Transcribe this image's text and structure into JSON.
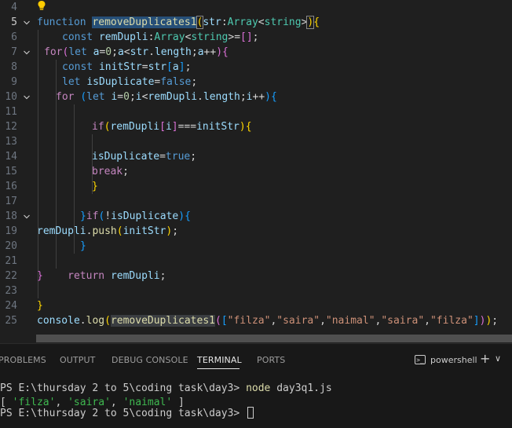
{
  "editor": {
    "line_numbers": [
      "4",
      "5",
      "6",
      "7",
      "8",
      "9",
      "10",
      "11",
      "12",
      "13",
      "14",
      "15",
      "16",
      "17",
      "18",
      "19",
      "20",
      "21",
      "22",
      "23",
      "24",
      "25"
    ],
    "lines": [
      {
        "tokens": []
      },
      {
        "tokens": [
          {
            "t": "function ",
            "c": "k"
          },
          {
            "t": "removeDuplicates1",
            "c": "f hl"
          },
          {
            "t": "(",
            "c": "b1 bracket-box"
          },
          {
            "t": "str",
            "c": "v"
          },
          {
            "t": ":",
            "c": "p"
          },
          {
            "t": "Array",
            "c": "t"
          },
          {
            "t": "<",
            "c": "p"
          },
          {
            "t": "string",
            "c": "t"
          },
          {
            "t": ">",
            "c": "p"
          },
          {
            "t": ")",
            "c": "b1 bracket-box"
          },
          {
            "t": "{",
            "c": "b1"
          }
        ]
      },
      {
        "tokens": [
          {
            "t": "const ",
            "c": "k"
          },
          {
            "t": "remDupli",
            "c": "v"
          },
          {
            "t": ":",
            "c": "p"
          },
          {
            "t": "Array",
            "c": "t"
          },
          {
            "t": "<",
            "c": "p"
          },
          {
            "t": "string",
            "c": "t"
          },
          {
            "t": ">",
            "c": "p"
          },
          {
            "t": "=",
            "c": "p"
          },
          {
            "t": "[]",
            "c": "b2"
          },
          {
            "t": ";",
            "c": "p"
          }
        ]
      },
      {
        "tokens": [
          {
            "t": "for",
            "c": "kc"
          },
          {
            "t": "(",
            "c": "b2"
          },
          {
            "t": "let ",
            "c": "k"
          },
          {
            "t": "a",
            "c": "v"
          },
          {
            "t": "=",
            "c": "p"
          },
          {
            "t": "0",
            "c": "n"
          },
          {
            "t": ";",
            "c": "p"
          },
          {
            "t": "a",
            "c": "v"
          },
          {
            "t": "<",
            "c": "p"
          },
          {
            "t": "str",
            "c": "v"
          },
          {
            "t": ".",
            "c": "p"
          },
          {
            "t": "length",
            "c": "v"
          },
          {
            "t": ";",
            "c": "p"
          },
          {
            "t": "a",
            "c": "v"
          },
          {
            "t": "++",
            "c": "p"
          },
          {
            "t": ")",
            "c": "b2"
          },
          {
            "t": "{",
            "c": "b2"
          }
        ]
      },
      {
        "tokens": [
          {
            "t": "const ",
            "c": "k"
          },
          {
            "t": "initStr",
            "c": "v"
          },
          {
            "t": "=",
            "c": "p"
          },
          {
            "t": "str",
            "c": "v"
          },
          {
            "t": "[",
            "c": "b3"
          },
          {
            "t": "a",
            "c": "v"
          },
          {
            "t": "]",
            "c": "b3"
          },
          {
            "t": ";",
            "c": "p"
          }
        ]
      },
      {
        "tokens": [
          {
            "t": "let ",
            "c": "k"
          },
          {
            "t": "isDuplicate",
            "c": "v"
          },
          {
            "t": "=",
            "c": "p"
          },
          {
            "t": "false",
            "c": "k"
          },
          {
            "t": ";",
            "c": "p"
          }
        ]
      },
      {
        "tokens": [
          {
            "t": "for ",
            "c": "kc"
          },
          {
            "t": "(",
            "c": "b3"
          },
          {
            "t": "let ",
            "c": "k"
          },
          {
            "t": "i",
            "c": "v"
          },
          {
            "t": "=",
            "c": "p"
          },
          {
            "t": "0",
            "c": "n"
          },
          {
            "t": ";",
            "c": "p"
          },
          {
            "t": "i",
            "c": "v"
          },
          {
            "t": "<",
            "c": "p"
          },
          {
            "t": "remDupli",
            "c": "v"
          },
          {
            "t": ".",
            "c": "p"
          },
          {
            "t": "length",
            "c": "v"
          },
          {
            "t": ";",
            "c": "p"
          },
          {
            "t": "i",
            "c": "v"
          },
          {
            "t": "++",
            "c": "p"
          },
          {
            "t": ")",
            "c": "b3"
          },
          {
            "t": "{",
            "c": "b3"
          }
        ]
      },
      {
        "tokens": []
      },
      {
        "tokens": [
          {
            "t": "if",
            "c": "kc"
          },
          {
            "t": "(",
            "c": "b1"
          },
          {
            "t": "remDupli",
            "c": "v"
          },
          {
            "t": "[",
            "c": "b2"
          },
          {
            "t": "i",
            "c": "v"
          },
          {
            "t": "]",
            "c": "b2"
          },
          {
            "t": "===",
            "c": "p"
          },
          {
            "t": "initStr",
            "c": "v"
          },
          {
            "t": ")",
            "c": "b1"
          },
          {
            "t": "{",
            "c": "b1"
          }
        ]
      },
      {
        "tokens": []
      },
      {
        "tokens": [
          {
            "t": "isDuplicate",
            "c": "v"
          },
          {
            "t": "=",
            "c": "p"
          },
          {
            "t": "true",
            "c": "k"
          },
          {
            "t": ";",
            "c": "p"
          }
        ]
      },
      {
        "tokens": [
          {
            "t": "break",
            "c": "kc"
          },
          {
            "t": ";",
            "c": "p"
          }
        ]
      },
      {
        "tokens": [
          {
            "t": "}",
            "c": "b1"
          }
        ]
      },
      {
        "tokens": []
      },
      {
        "tokens": [
          {
            "t": "}",
            "c": "b3"
          },
          {
            "t": "if",
            "c": "kc"
          },
          {
            "t": "(",
            "c": "b3"
          },
          {
            "t": "!",
            "c": "p"
          },
          {
            "t": "isDuplicate",
            "c": "v"
          },
          {
            "t": ")",
            "c": "b3"
          },
          {
            "t": "{",
            "c": "b3"
          }
        ]
      },
      {
        "tokens": [
          {
            "t": "remDupli",
            "c": "v"
          },
          {
            "t": ".",
            "c": "p"
          },
          {
            "t": "push",
            "c": "f"
          },
          {
            "t": "(",
            "c": "b1"
          },
          {
            "t": "initStr",
            "c": "v"
          },
          {
            "t": ")",
            "c": "b1"
          },
          {
            "t": ";",
            "c": "p"
          }
        ]
      },
      {
        "tokens": [
          {
            "t": "}",
            "c": "b3"
          }
        ]
      },
      {
        "tokens": []
      },
      {
        "tokens": [
          {
            "t": "}",
            "c": "b2"
          },
          {
            "t": "    ",
            "c": "p"
          },
          {
            "t": "return ",
            "c": "kc"
          },
          {
            "t": "remDupli",
            "c": "v"
          },
          {
            "t": ";",
            "c": "p"
          }
        ]
      },
      {
        "tokens": []
      },
      {
        "tokens": [
          {
            "t": "}",
            "c": "b1"
          }
        ]
      },
      {
        "tokens": [
          {
            "t": "console",
            "c": "v"
          },
          {
            "t": ".",
            "c": "p"
          },
          {
            "t": "log",
            "c": "f"
          },
          {
            "t": "(",
            "c": "b1"
          },
          {
            "t": "removeDuplicates1",
            "c": "f hlb"
          },
          {
            "t": "(",
            "c": "b2"
          },
          {
            "t": "[",
            "c": "b3"
          },
          {
            "t": "\"filza\"",
            "c": "s"
          },
          {
            "t": ",",
            "c": "p"
          },
          {
            "t": "\"saira\"",
            "c": "s"
          },
          {
            "t": ",",
            "c": "p"
          },
          {
            "t": "\"naimal\"",
            "c": "s"
          },
          {
            "t": ",",
            "c": "p"
          },
          {
            "t": "\"saira\"",
            "c": "s"
          },
          {
            "t": ",",
            "c": "p"
          },
          {
            "t": "\"filza\"",
            "c": "s"
          },
          {
            "t": "]",
            "c": "b3"
          },
          {
            "t": ")",
            "c": "b2"
          },
          {
            "t": ")",
            "c": "b1"
          },
          {
            "t": ";",
            "c": "p"
          }
        ]
      }
    ]
  },
  "panel": {
    "tabs": [
      "PROBLEMS",
      "OUTPUT",
      "DEBUG CONSOLE",
      "TERMINAL",
      "PORTS"
    ],
    "active_tab": "TERMINAL",
    "terminal_name": "powershell",
    "plus_label": "+",
    "chevron_label": "∨",
    "terminal": {
      "prompt1": "PS E:\\thursday 2 to 5\\coding task\\day3> ",
      "command1_cmd": "node",
      "command1_arg": " day3q1.js",
      "output_open": "[ ",
      "output_v1": "'filza'",
      "output_sep1": ", ",
      "output_v2": "'saira'",
      "output_sep2": ", ",
      "output_v3": "'naimal'",
      "output_close": " ]",
      "prompt2": "PS E:\\thursday 2 to 5\\coding task\\day3> "
    }
  }
}
